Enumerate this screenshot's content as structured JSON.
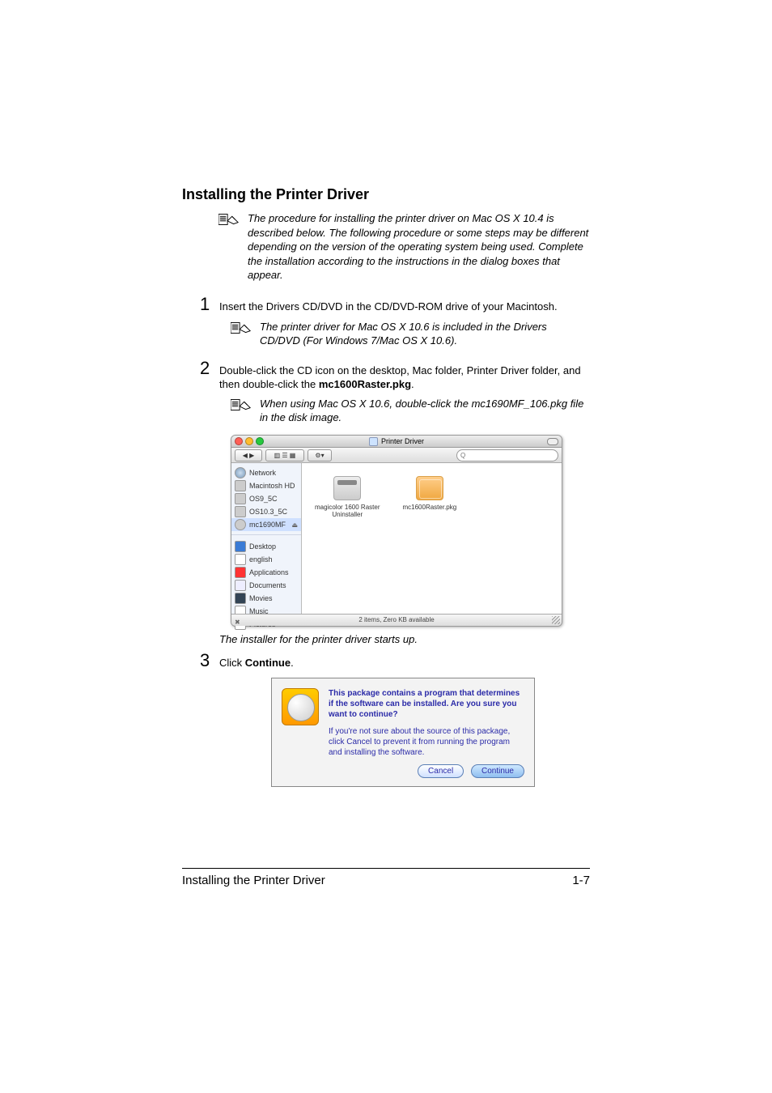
{
  "heading": "Installing the Printer Driver",
  "note1": "The procedure for installing the printer driver on Mac OS X 10.4 is described below. The following procedure or some steps may be different depending on the version of the operating system being used. Complete the installation according to the instructions in the dialog boxes that appear.",
  "step1": "Insert the Drivers CD/DVD in the CD/DVD-ROM drive of your Macintosh.",
  "note1b": "The printer driver for Mac OS X 10.6 is included in the Drivers CD/DVD (For Windows 7/Mac OS X 10.6).",
  "step2_a": "Double-click the CD icon on the desktop, Mac folder, Printer Driver folder, and then double-click the ",
  "step2_pkg": "mc1600Raster.pkg",
  "step2_b": ".",
  "note2b": "When using Mac OS X 10.6, double-click the mc1690MF_106.pkg file in the disk image.",
  "finder": {
    "title": "Printer Driver",
    "search_glyph": "Q",
    "nav_glyph": "◀ ▶",
    "view_glyph": "▥ ☰ ▦",
    "gear_glyph": "⚙▾",
    "sidebar": [
      "Network",
      "Macintosh HD",
      "OS9_5C",
      "OS10.3_5C",
      "mc1690MF",
      "Desktop",
      "english",
      "Applications",
      "Documents",
      "Movies",
      "Music",
      "Pictures"
    ],
    "item1_l1": "magicolor 1600 Raster",
    "item1_l2": "Uninstaller",
    "item2": "mc1600Raster.pkg",
    "status": "2 items, Zero KB available",
    "status_cog": "✖"
  },
  "caption": "The installer for the printer driver starts up.",
  "step3_a": "Click ",
  "step3_b": "Continue",
  "step3_c": ".",
  "dialog": {
    "title": "This package contains a program that determines if the software can be installed.  Are you sure you want to continue?",
    "body": "If you're not sure about the source of this package, click Cancel to prevent it from running the program and installing the software.",
    "cancel": "Cancel",
    "continue": "Continue"
  },
  "footer": {
    "left": "Installing the Printer Driver",
    "right": "1-7"
  }
}
